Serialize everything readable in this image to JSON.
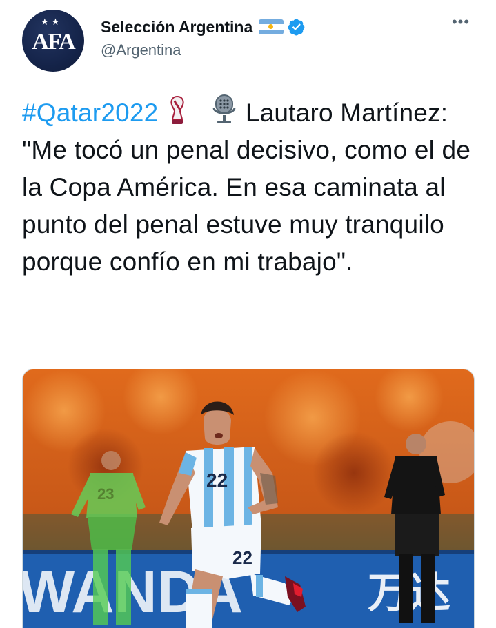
{
  "author": {
    "display_name": "Selección Argentina",
    "handle": "@Argentina",
    "avatar_text": "AFA",
    "avatar_stars": "★★",
    "flag_icon": "argentina-flag-icon",
    "verified_icon": "verified-badge-icon",
    "more_icon": "more-options-icon",
    "more_label": "•••"
  },
  "tweet": {
    "hashtag": "#Qatar2022",
    "body": "Lautaro Martínez: \"Me tocó un penal decisivo, como el de la Copa América. En esa caminata al punto del penal estuve muy tranquilo porque confío en mi trabajo\".",
    "emojis": [
      "world-cup-trophy-icon",
      "microphone-icon"
    ]
  },
  "media": {
    "jersey_number": "22",
    "board_text_left": "WANDA",
    "board_text_right": "万达"
  },
  "colors": {
    "accent": "#1d9bf0",
    "text": "#0f1419",
    "secondary": "#536471"
  }
}
